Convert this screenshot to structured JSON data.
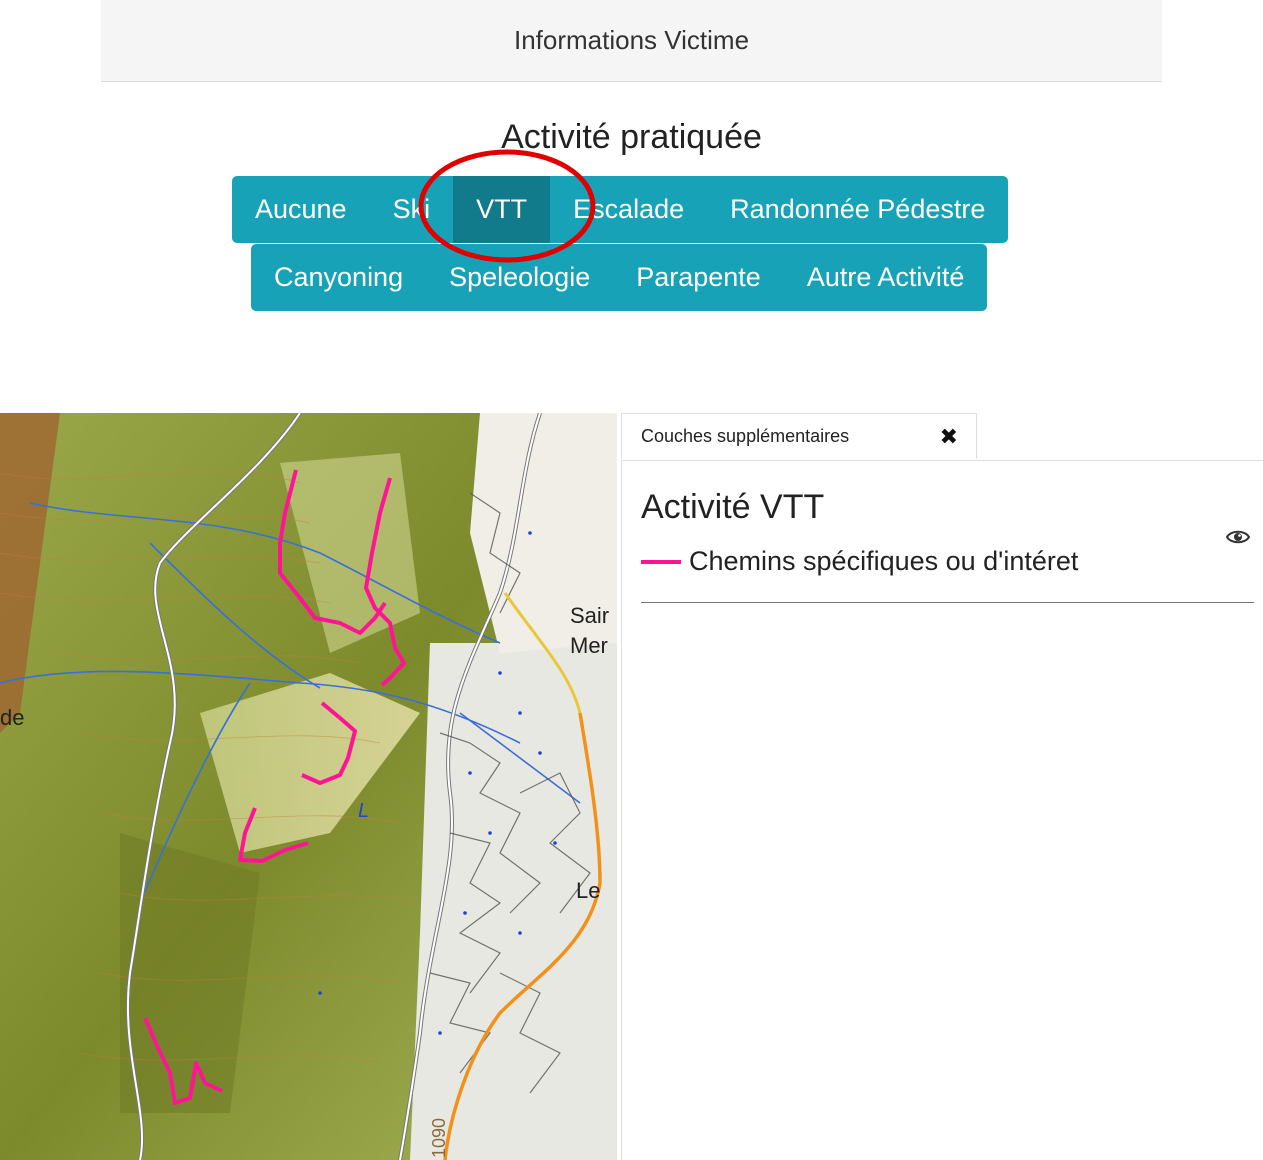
{
  "header": {
    "title": "Informations Victime"
  },
  "activity": {
    "title": "Activité pratiquée",
    "row1": [
      "Aucune",
      "Ski",
      "VTT",
      "Escalade",
      "Randonnée Pédestre"
    ],
    "row2": [
      "Canyoning",
      "Speleologie",
      "Parapente",
      "Autre Activité"
    ],
    "selected": "VTT"
  },
  "map": {
    "labels": {
      "town1": "Sair",
      "town2": "Mer",
      "town3": "Le",
      "elev1": "1090",
      "left_edge": "de",
      "marker": "L"
    }
  },
  "panel": {
    "tab_label": "Couches supplémentaires",
    "close_icon": "close-icon",
    "layer_title": "Activité VTT",
    "legend_label": "Chemins spécifiques ou d'intéret",
    "legend_color": "#ff1493",
    "eye_icon": "eye-icon"
  },
  "colors": {
    "button_bg": "#17a2b8",
    "button_active": "#117a8b",
    "highlight_circle": "#e00000"
  }
}
